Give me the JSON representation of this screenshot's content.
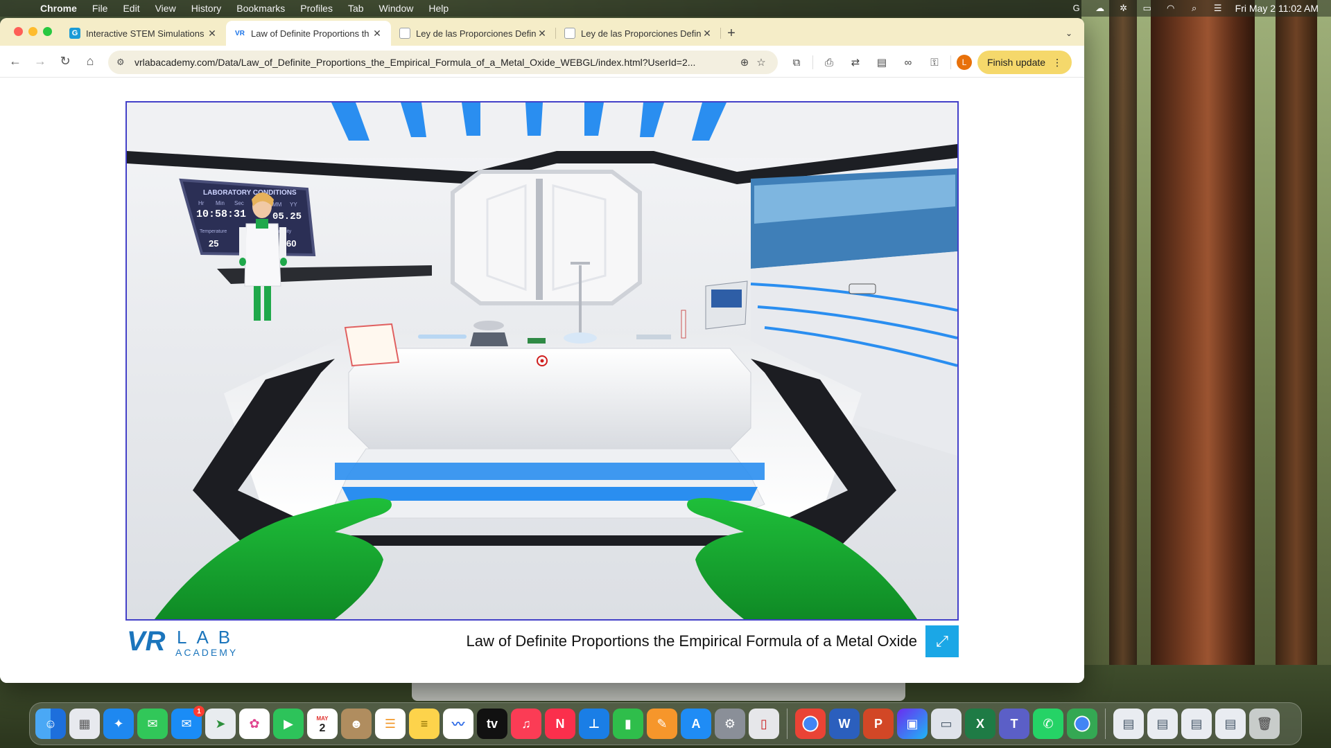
{
  "menubar": {
    "app": "Chrome",
    "items": [
      "File",
      "Edit",
      "View",
      "History",
      "Bookmarks",
      "Profiles",
      "Tab",
      "Window",
      "Help"
    ],
    "datetime": "Fri May 2  11:02 AM"
  },
  "tabs": [
    {
      "title": "Interactive STEM Simulations",
      "favicon": "G",
      "color": "#1a9bd7"
    },
    {
      "title": "Law of Definite Proportions th",
      "favicon": "VR",
      "color": "#1a73e8"
    },
    {
      "title": "Ley de las Proporciones Defin",
      "favicon": "doc",
      "color": "#9aa0a6"
    },
    {
      "title": "Ley de las Proporciones Defin",
      "favicon": "doc",
      "color": "#9aa0a6"
    }
  ],
  "omnibox": {
    "url": "vrlabacademy.com/Data/Law_of_Definite_Proportions_the_Empirical_Formula_of_a_Metal_Oxide_WEBGL/index.html?UserId=2..."
  },
  "toolbar": {
    "profile_initial": "L",
    "finish_update": "Finish update"
  },
  "page": {
    "logo_vr": "VR",
    "logo_lab": "LAB",
    "logo_academy": "ACADEMY",
    "caption": "Law of Definite Proportions the Empirical Formula of a Metal Oxide"
  },
  "scene": {
    "panel_title": "LABORATORY CONDITIONS",
    "labels": [
      "Hr",
      "Min",
      "Sec",
      "MM",
      "YY",
      "Temperature",
      "Humidity"
    ],
    "time": "10:58:31",
    "date": "05.25",
    "temperature": "25",
    "humidity": "60"
  },
  "dock": {
    "mail_badge": "1",
    "calendar_month": "MAY",
    "calendar_day": "2"
  },
  "colors": {
    "accent": "#1ba7e6",
    "viewport_border": "#4340c8",
    "finish_update": "#f5d86b",
    "tabstrip": "#f5edc8"
  }
}
